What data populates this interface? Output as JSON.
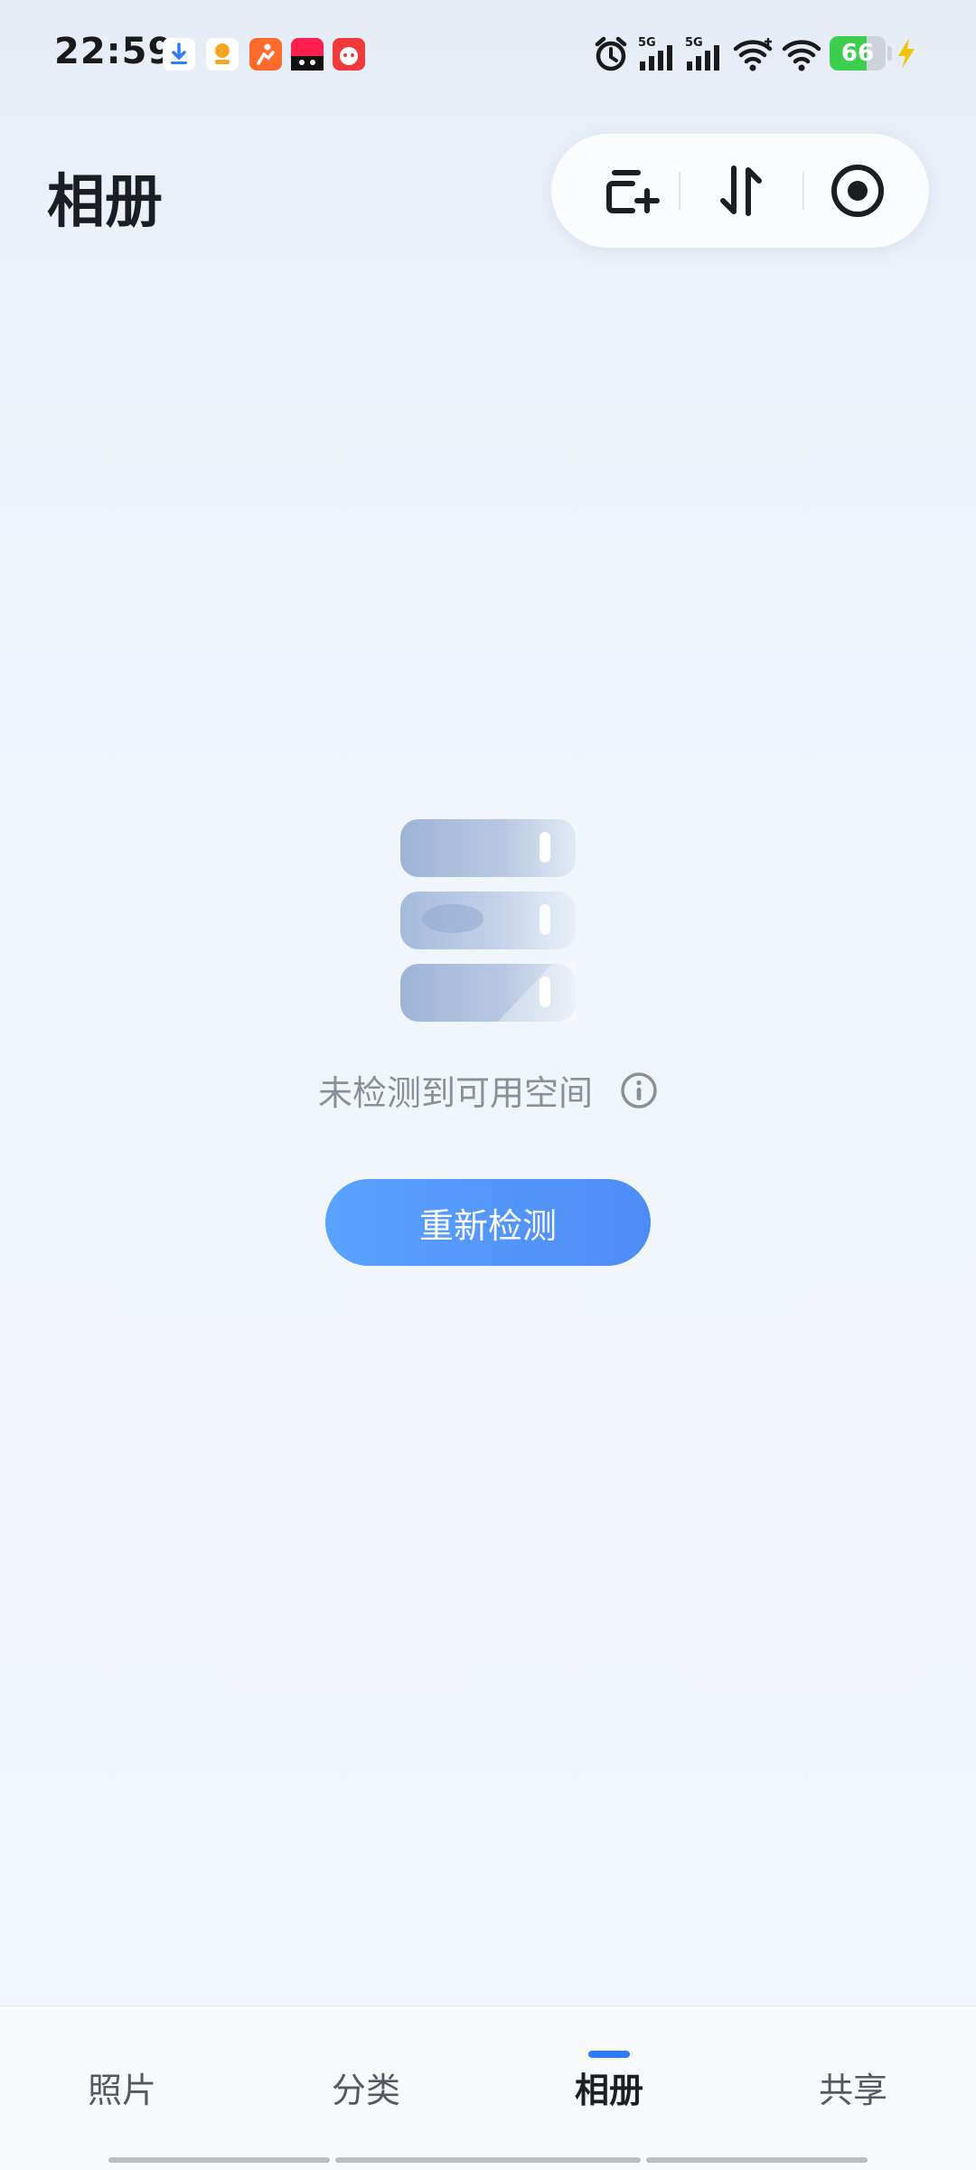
{
  "status_bar": {
    "time": "22:59",
    "notification_icons": [
      "download-icon",
      "app-notification-icon",
      "app-notification-icon",
      "app-notification-icon",
      "app-notification-icon"
    ],
    "signal_1_label": "5G",
    "signal_2_label": "5G",
    "battery_level": "66",
    "battery_percent": 66,
    "battery_color": "#3ccf4e"
  },
  "header": {
    "title": "相册",
    "toolbar": [
      "create-album-icon",
      "sort-icon",
      "more-icon"
    ]
  },
  "empty_state": {
    "message": "未检测到可用空间",
    "button_label": "重新检测"
  },
  "bottom_nav": {
    "tabs": [
      {
        "label": "照片",
        "active": false
      },
      {
        "label": "分类",
        "active": false
      },
      {
        "label": "相册",
        "active": true
      },
      {
        "label": "共享",
        "active": false
      }
    ],
    "accent": "#2f7cf6"
  }
}
